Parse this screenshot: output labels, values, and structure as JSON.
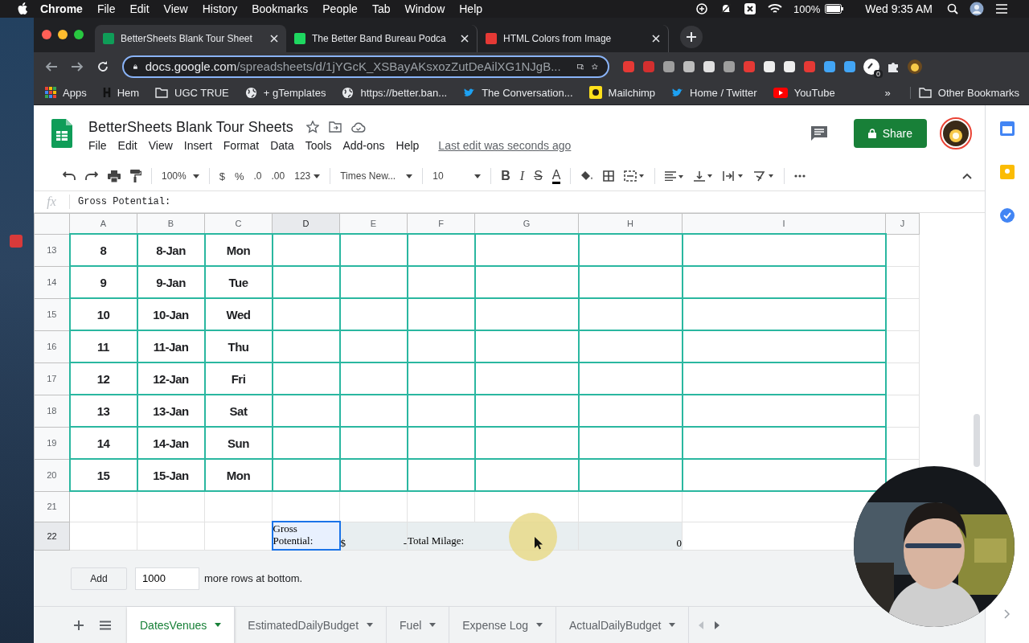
{
  "menubar": {
    "app": "Chrome",
    "items": [
      "File",
      "Edit",
      "View",
      "History",
      "Bookmarks",
      "People",
      "Tab",
      "Window",
      "Help"
    ],
    "battery": "100%",
    "clock": "Wed 9:35 AM"
  },
  "browser_tabs": [
    {
      "title": "BetterSheets Blank Tour Sheet",
      "selected": true,
      "color": "#0f9d58"
    },
    {
      "title": "The Better Band Bureau Podca",
      "selected": false,
      "color": "#1ed760"
    },
    {
      "title": "HTML Colors from Image",
      "selected": false,
      "color": "#e53935"
    }
  ],
  "address": {
    "host": "docs.google.com",
    "path": "/spreadsheets/d/1jYGcK_XSBayAKsxozZutDeAilXG1NJgB..."
  },
  "extension_badge": "0",
  "bookmarks": [
    {
      "label": "Apps",
      "kind": "apps"
    },
    {
      "label": "Hem",
      "kind": "letter"
    },
    {
      "label": "UGC TRUE",
      "kind": "folder"
    },
    {
      "label": "+ gTemplates",
      "kind": "globe"
    },
    {
      "label": "https://better.ban...",
      "kind": "globe"
    },
    {
      "label": "The Conversation...",
      "kind": "bird"
    },
    {
      "label": "Mailchimp",
      "kind": "mail"
    },
    {
      "label": "Home / Twitter",
      "kind": "bird"
    },
    {
      "label": "YouTube",
      "kind": "video"
    }
  ],
  "bookmarks_overflow": "»",
  "other_bookmarks": "Other Bookmarks",
  "doc": {
    "title": "BetterSheets Blank Tour Sheets",
    "menus": [
      "File",
      "Edit",
      "View",
      "Insert",
      "Format",
      "Data",
      "Tools",
      "Add-ons",
      "Help"
    ],
    "last_edit": "Last edit was seconds ago",
    "share": "Share"
  },
  "toolbar": {
    "zoom": "100%",
    "currency": "$",
    "percent": "%",
    "dec_less": ".0",
    "dec_more": ".00",
    "format": "123",
    "font": "Times New...",
    "size": "10",
    "bold": "B",
    "italic": "I",
    "strike": "S",
    "text_color": "A"
  },
  "formula": {
    "label": "fx",
    "value": "Gross Potential:"
  },
  "columns": [
    "A",
    "B",
    "C",
    "D",
    "E",
    "F",
    "G",
    "H",
    "I",
    "J"
  ],
  "rows": [
    {
      "row": "13",
      "cells": [
        "8",
        "8-Jan",
        "Mon"
      ]
    },
    {
      "row": "14",
      "cells": [
        "9",
        "9-Jan",
        "Tue"
      ]
    },
    {
      "row": "15",
      "cells": [
        "10",
        "10-Jan",
        "Wed"
      ]
    },
    {
      "row": "16",
      "cells": [
        "11",
        "11-Jan",
        "Thu"
      ]
    },
    {
      "row": "17",
      "cells": [
        "12",
        "12-Jan",
        "Fri"
      ]
    },
    {
      "row": "18",
      "cells": [
        "13",
        "13-Jan",
        "Sat"
      ]
    },
    {
      "row": "19",
      "cells": [
        "14",
        "14-Jan",
        "Sun"
      ]
    },
    {
      "row": "20",
      "cells": [
        "15",
        "15-Jan",
        "Mon"
      ]
    }
  ],
  "empty_row": "21",
  "summary_row": {
    "row": "22",
    "gross_label": "Gross Potential:",
    "selected": true,
    "currency": "$",
    "amount": "-",
    "milage_label": "Total Milage:",
    "milage": "0"
  },
  "add_rows": {
    "button": "Add",
    "count": "1000",
    "suffix": "more rows at bottom."
  },
  "sheet_tabs": [
    {
      "label": "DatesVenues",
      "selected": true
    },
    {
      "label": "EstimatedDailyBudget",
      "selected": false
    },
    {
      "label": "Fuel",
      "selected": false
    },
    {
      "label": "Expense Log",
      "selected": false
    },
    {
      "label": "ActualDailyBudget",
      "selected": false
    }
  ]
}
